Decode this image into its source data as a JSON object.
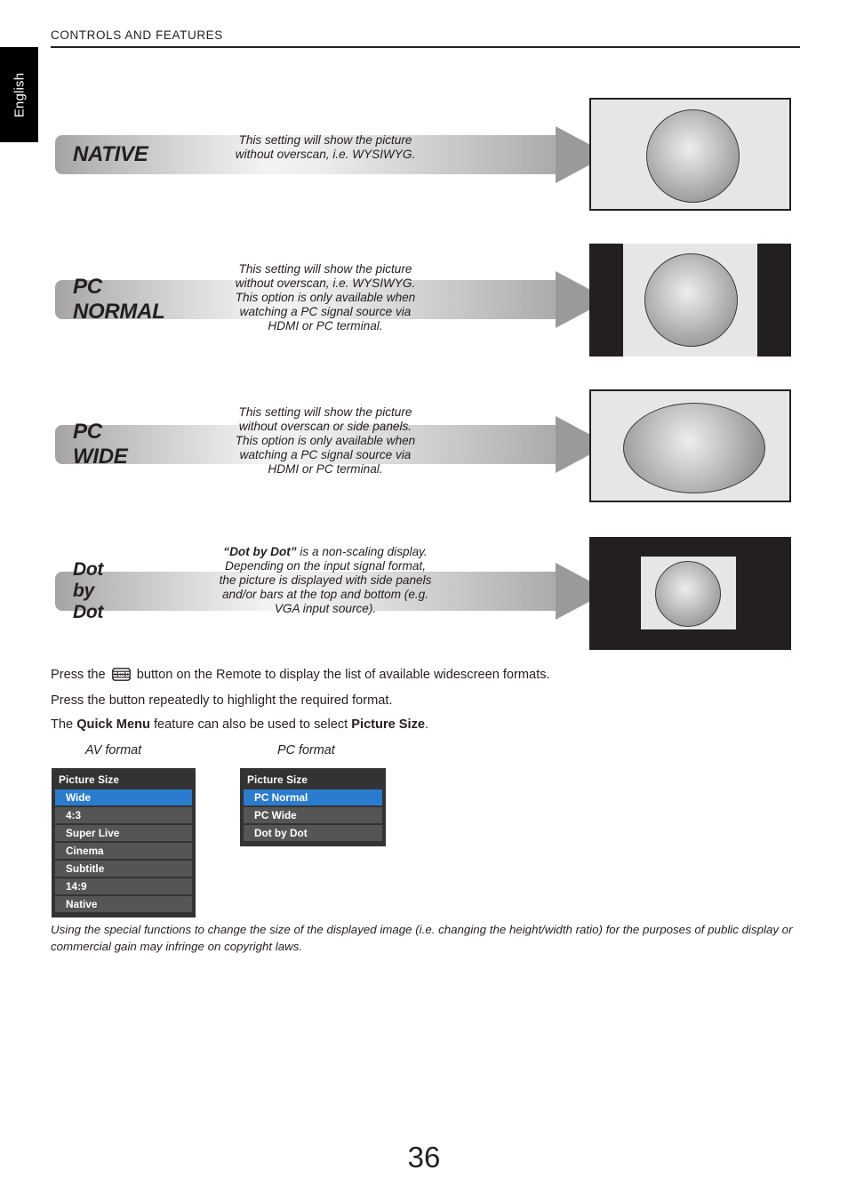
{
  "header": {
    "title": "CONTROLS AND FEATURES",
    "language_tab": "English"
  },
  "formats": [
    {
      "name": "NATIVE",
      "description": "This setting will show the picture\nwithout overscan, i.e. WYSIWYG.",
      "illustration": "full-screen-gray-panel-with-circle"
    },
    {
      "name": "PC NORMAL",
      "description": "This setting will show the picture\nwithout overscan, i.e. WYSIWYG.\nThis option is only available when\nwatching a PC signal source via\nHDMI or PC terminal.",
      "illustration": "black-side-bars-with-circle"
    },
    {
      "name": "PC WIDE",
      "description": "This setting will show the picture\nwithout overscan or side panels.\nThis option is only available when\nwatching a PC signal source via\nHDMI or PC terminal.",
      "illustration": "full-screen-gray-panel-with-wide-ellipse"
    },
    {
      "name": "Dot by Dot",
      "description_bold": "“Dot by Dot”",
      "description": " is a non-scaling display.\nDepending on the input signal format,\nthe picture is displayed with side panels\nand/or bars at the top and bottom (e.g.\nVGA input source).",
      "illustration": "black-frame-with-small-centered-panel"
    }
  ],
  "instructions": {
    "line1_pre": "Press the ",
    "line1_icon": "widescreen-format-button-icon",
    "line1_post": " button on the Remote to display the list of available widescreen formats.",
    "line2": "Press the button repeatedly to highlight the required format.",
    "line3_pre": "The ",
    "line3_bold1": "Quick Menu",
    "line3_mid": " feature can also be used to select ",
    "line3_bold2": "Picture Size",
    "line3_post": "."
  },
  "menus": {
    "av": {
      "caption": "AV format",
      "title": "Picture Size",
      "items": [
        "Wide",
        "4:3",
        "Super Live",
        "Cinema",
        "Subtitle",
        "14:9",
        "Native"
      ],
      "selected_index": 0
    },
    "pc": {
      "caption": "PC format",
      "title": "Picture Size",
      "items": [
        "PC Normal",
        "PC Wide",
        "Dot by Dot"
      ],
      "selected_index": 0
    }
  },
  "copyright_note": "Using the special functions to change the size of the displayed image (i.e. changing the height/width ratio) for the purposes of public display or commercial gain may infringe on copyright laws.",
  "page_number": "36",
  "colors": {
    "selected_menu": "#2b7bce",
    "menu_item": "#555555",
    "menu_bg": "#333333",
    "ink": "#231f20",
    "panel": "#e6e6e6"
  }
}
